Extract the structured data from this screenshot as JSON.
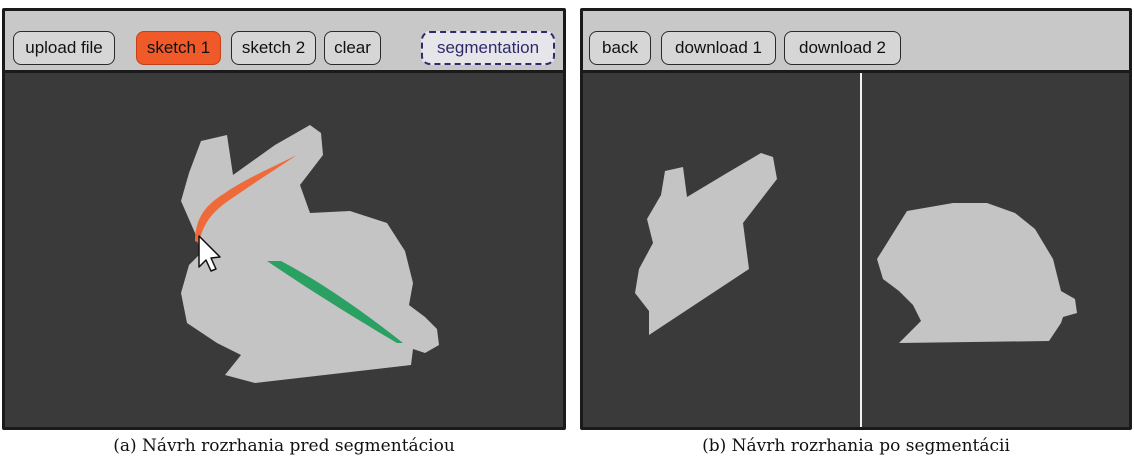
{
  "panel_a": {
    "toolbar": {
      "buttons": [
        {
          "label": "upload file",
          "state": "normal"
        },
        {
          "label": "sketch 1",
          "state": "active"
        },
        {
          "label": "sketch 2",
          "state": "normal"
        },
        {
          "label": "clear",
          "state": "normal"
        },
        {
          "label": "segmentation",
          "state": "dashed"
        }
      ]
    },
    "caption": "(a) Návrh rozrhania pred segmentáciou"
  },
  "panel_b": {
    "toolbar": {
      "buttons": [
        {
          "label": "back"
        },
        {
          "label": "download 1"
        },
        {
          "label": "download 2"
        }
      ]
    },
    "caption": "(b) Návrh rozrhania po segmentácii"
  },
  "colors": {
    "canvas": "#3a3a3a",
    "toolbar": "#c8c8c8",
    "shape": "#c4c4c4",
    "sketch_1": "#ef6a3a",
    "sketch_2": "#2aa062",
    "segmentation_outline": "#2e2a6b"
  },
  "icons": [
    "mouse-cursor-icon"
  ]
}
